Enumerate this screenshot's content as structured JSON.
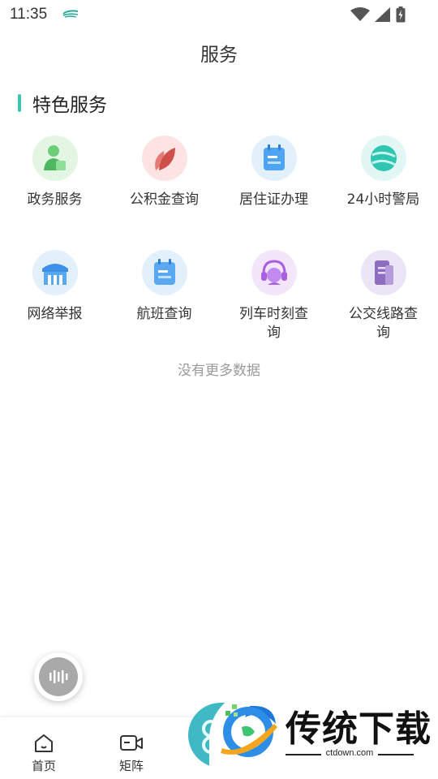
{
  "status_bar": {
    "time": "11:35"
  },
  "header": {
    "title": "服务"
  },
  "section": {
    "title": "特色服务"
  },
  "services": [
    {
      "label": "政务服务",
      "icon": "government-service-icon",
      "bg": "#e3f6e3",
      "color": "#5bc46a"
    },
    {
      "label": "公积金查询",
      "icon": "housing-fund-icon",
      "bg": "#fde3e3",
      "color": "#d9625d"
    },
    {
      "label": "居住证办理",
      "icon": "residence-permit-icon",
      "bg": "#e2f0fc",
      "color": "#4a9ff0"
    },
    {
      "label": "24小时警局",
      "icon": "police-station-icon",
      "bg": "#e2f7f4",
      "color": "#2ec6b0"
    },
    {
      "label": "网络举报",
      "icon": "network-report-icon",
      "bg": "#e2f0fc",
      "color": "#3d8fe8"
    },
    {
      "label": "航班查询",
      "icon": "flight-query-icon",
      "bg": "#e2f0fc",
      "color": "#4a9ff0"
    },
    {
      "label": "列车时刻查询",
      "icon": "train-schedule-icon",
      "bg": "#f3e6fb",
      "color": "#a85fe0"
    },
    {
      "label": "公交线路查询",
      "icon": "bus-route-icon",
      "bg": "#ebe6f6",
      "color": "#8c6dbf"
    }
  ],
  "footer_note": "没有更多数据",
  "bottom_nav": [
    {
      "label": "首页",
      "icon": "home-icon"
    },
    {
      "label": "矩阵",
      "icon": "video-matrix-icon"
    }
  ],
  "watermark": {
    "brand": "传统下载",
    "domain": "ctdown.com"
  },
  "colors": {
    "accent": "#3fc3b3",
    "text": "#333333",
    "muted": "#9a9a9a"
  }
}
